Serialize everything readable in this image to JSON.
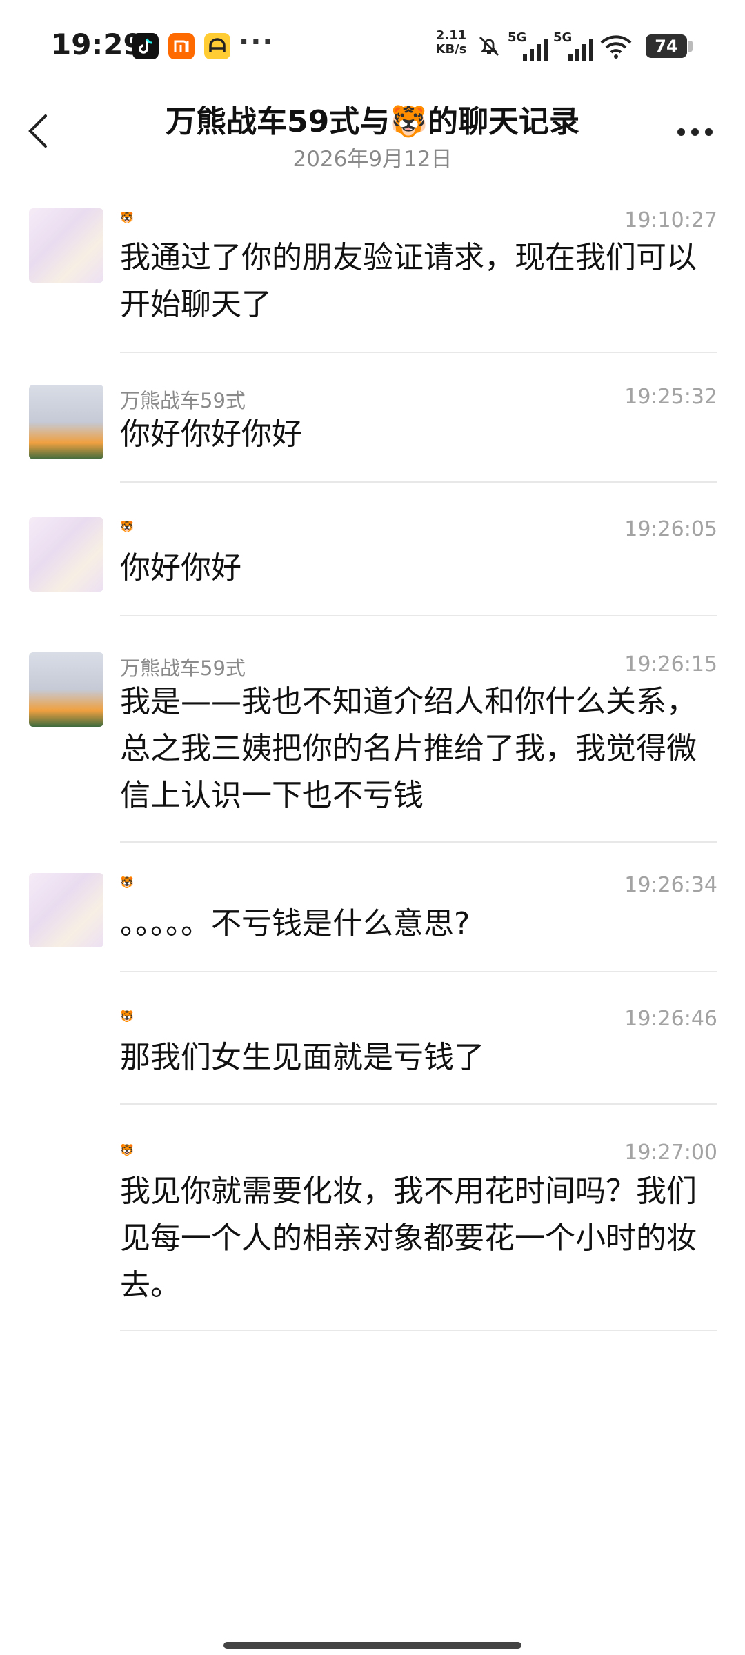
{
  "status_bar": {
    "time": "19:29",
    "app_icons": [
      "tiktok-icon",
      "mi-icon",
      "car-app-icon"
    ],
    "more": "···",
    "speed_value": "2.11",
    "speed_unit": "KB/s",
    "network_1": "5G",
    "network_2": "5G",
    "battery": "74"
  },
  "header": {
    "title": "万熊战车59式与🐯的聊天记录",
    "date": "2026年9月12日"
  },
  "messages": [
    {
      "sender": "🐯",
      "time": "19:10:27",
      "text": "我通过了你的朋友验证请求，现在我们可以开始聊天了"
    },
    {
      "sender": "万熊战车59式",
      "time": "19:25:32",
      "text": "你好你好你好"
    },
    {
      "sender": "🐯",
      "time": "19:26:05",
      "text": "你好你好"
    },
    {
      "sender": "万熊战车59式",
      "time": "19:26:15",
      "text": "我是——我也不知道介绍人和你什么关系，总之我三姨把你的名片推给了我，我觉得微信上认识一下也不亏钱"
    },
    {
      "sender": "🐯",
      "time": "19:26:34",
      "text": "。。。。。不亏钱是什么意思?"
    },
    {
      "sender": "🐯",
      "time": "19:26:46",
      "text": "那我们女生见面就是亏钱了"
    },
    {
      "sender": "🐯",
      "time": "19:27:00",
      "text": "我见你就需要化妆，我不用花时间吗？我们见每一个人的相亲对象都要花一个小时的妆去。"
    }
  ]
}
